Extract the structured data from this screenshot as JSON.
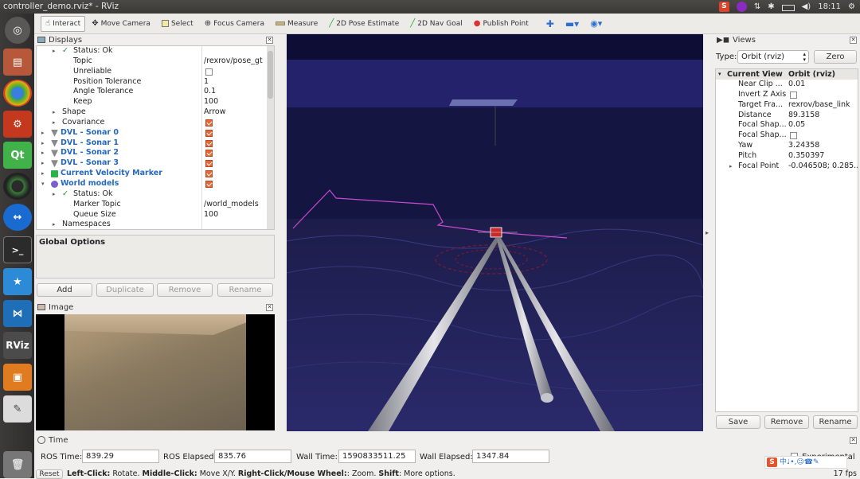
{
  "window": {
    "title": "controller_demo.rviz* - RViz"
  },
  "tray": {
    "time": "18:11",
    "power_icon": "gear-icon"
  },
  "toolbar": {
    "items": [
      {
        "label": "Interact",
        "icon": "cursor-icon"
      },
      {
        "label": "Move Camera",
        "icon": "move-icon"
      },
      {
        "label": "Select",
        "icon": "select-icon"
      },
      {
        "label": "Focus Camera",
        "icon": "focus-icon"
      },
      {
        "label": "Measure",
        "icon": "ruler-icon"
      },
      {
        "label": "2D Pose Estimate",
        "icon": "arrow-green-icon"
      },
      {
        "label": "2D Nav Goal",
        "icon": "arrow-green-icon"
      },
      {
        "label": "Publish Point",
        "icon": "pin-icon"
      }
    ]
  },
  "displays": {
    "title": "Displays",
    "rows": [
      {
        "key": "Status: Ok",
        "value": "",
        "indent": 1,
        "arrow": "▸",
        "check": "✓"
      },
      {
        "key": "Topic",
        "value": "/rexrov/pose_gt",
        "indent": 2
      },
      {
        "key": "Unreliable",
        "value": "",
        "indent": 2,
        "box": "off"
      },
      {
        "key": "Position Tolerance",
        "value": "1",
        "indent": 2
      },
      {
        "key": "Angle Tolerance",
        "value": "0.1",
        "indent": 2
      },
      {
        "key": "Keep",
        "value": "100",
        "indent": 2
      },
      {
        "key": "Shape",
        "value": "Arrow",
        "indent": 1,
        "arrow": "▸"
      },
      {
        "key": "Covariance",
        "value": "",
        "indent": 1,
        "arrow": "▸",
        "box": "on"
      },
      {
        "key": "DVL - Sonar 0",
        "value": "",
        "indent": 0,
        "arrow": "▸",
        "box": "on",
        "blue": true
      },
      {
        "key": "DVL - Sonar 1",
        "value": "",
        "indent": 0,
        "arrow": "▸",
        "box": "on",
        "blue": true
      },
      {
        "key": "DVL - Sonar 2",
        "value": "",
        "indent": 0,
        "arrow": "▸",
        "box": "on",
        "blue": true
      },
      {
        "key": "DVL - Sonar 3",
        "value": "",
        "indent": 0,
        "arrow": "▸",
        "box": "on",
        "blue": true
      },
      {
        "key": "Current Velocity Marker",
        "value": "",
        "indent": 0,
        "arrow": "▸",
        "box": "on",
        "blue": true
      },
      {
        "key": "World models",
        "value": "",
        "indent": 0,
        "arrow": "▾",
        "box": "on",
        "blue": true
      },
      {
        "key": "Status: Ok",
        "value": "",
        "indent": 1,
        "arrow": "▸",
        "check": "✓"
      },
      {
        "key": "Marker Topic",
        "value": "/world_models",
        "indent": 2
      },
      {
        "key": "Queue Size",
        "value": "100",
        "indent": 2
      },
      {
        "key": "Namespaces",
        "value": "",
        "indent": 1,
        "arrow": "▸"
      }
    ],
    "description_title": "Global Options",
    "buttons": {
      "add": "Add",
      "duplicate": "Duplicate",
      "remove": "Remove",
      "rename": "Rename"
    }
  },
  "image_panel": {
    "title": "Image"
  },
  "views": {
    "title": "Views",
    "type_label": "Type:",
    "type_value": "Orbit (rviz)",
    "zero": "Zero",
    "header_key": "Current View",
    "header_value": "Orbit (rviz)",
    "rows": [
      {
        "key": "Near Clip ...",
        "value": "0.01"
      },
      {
        "key": "Invert Z Axis",
        "value": "",
        "box": "off"
      },
      {
        "key": "Target Fra...",
        "value": "rexrov/base_link"
      },
      {
        "key": "Distance",
        "value": "89.3158"
      },
      {
        "key": "Focal Shap...",
        "value": "0.05"
      },
      {
        "key": "Focal Shap...",
        "value": "",
        "box": "off"
      },
      {
        "key": "Yaw",
        "value": "3.24358"
      },
      {
        "key": "Pitch",
        "value": "0.350397"
      },
      {
        "key": "Focal Point",
        "value": "-0.046508; 0.285...",
        "arrow": "▸"
      }
    ],
    "buttons": {
      "save": "Save",
      "remove": "Remove",
      "rename": "Rename"
    }
  },
  "time": {
    "title": "Time",
    "ros_time_label": "ROS Time:",
    "ros_time": "839.29",
    "ros_elapsed_label": "ROS Elapsed:",
    "ros_elapsed": "835.76",
    "wall_time_label": "Wall Time:",
    "wall_time": "1590833511.25",
    "wall_elapsed_label": "Wall Elapsed:",
    "wall_elapsed": "1347.84",
    "experimental": "Experimental"
  },
  "status": {
    "reset": "Reset",
    "hint_parts": [
      {
        "text": "Left-Click:",
        "bold": true
      },
      {
        "text": " Rotate. ",
        "bold": false
      },
      {
        "text": "Middle-Click:",
        "bold": true
      },
      {
        "text": " Move X/Y. ",
        "bold": false
      },
      {
        "text": "Right-Click/Mouse Wheel:",
        "bold": true
      },
      {
        "text": ": Zoom. ",
        "bold": false
      },
      {
        "text": "Shift",
        "bold": true
      },
      {
        "text": ": More options.",
        "bold": false
      }
    ],
    "fps": "17 fps"
  }
}
